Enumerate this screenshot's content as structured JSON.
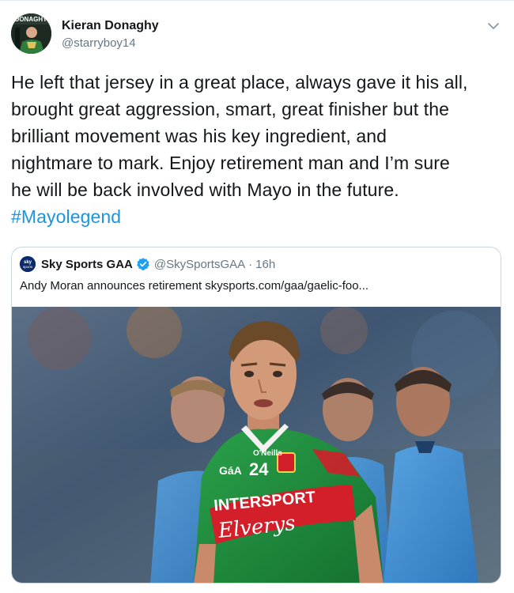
{
  "tweet": {
    "author": {
      "display_name": "Kieran Donaghy",
      "handle": "@starryboy14",
      "avatar_icon": "profile-photo-icon",
      "avatar_text": "DONAGHY"
    },
    "text_lines": [
      "He left that jersey in a great place, always gave it his all,",
      "brought great aggression, smart, great finisher but the",
      "brilliant movement was his key ingredient, and",
      "nightmare to mark. Enjoy retirement man and I’m sure",
      "he will be back involved with Mayo in the future."
    ],
    "hashtag": "#Mayolegend",
    "menu_icon": "chevron-down-icon"
  },
  "quoted_tweet": {
    "display_name": "Sky Sports GAA",
    "verified_icon": "verified-badge-icon",
    "logo_icon": "sky-sports-logo-icon",
    "logo_text_top": "sky",
    "logo_text_bottom": "sports",
    "handle": "@SkySportsGAA",
    "separator": "·",
    "time": "16h",
    "text": "Andy Moran announces retirement skysports.com/gaa/gaelic-foo...",
    "image": {
      "jersey_number": "24",
      "sponsor_top": "INTERSPORT",
      "sponsor_bottom": "Elverys",
      "brand": "O'Neills",
      "gaa_mark": "GáA",
      "colors": {
        "mayo_green": "#1f8a3c",
        "mayo_red": "#d21f2a",
        "dublin_blue": "#3a8fd6"
      }
    }
  }
}
